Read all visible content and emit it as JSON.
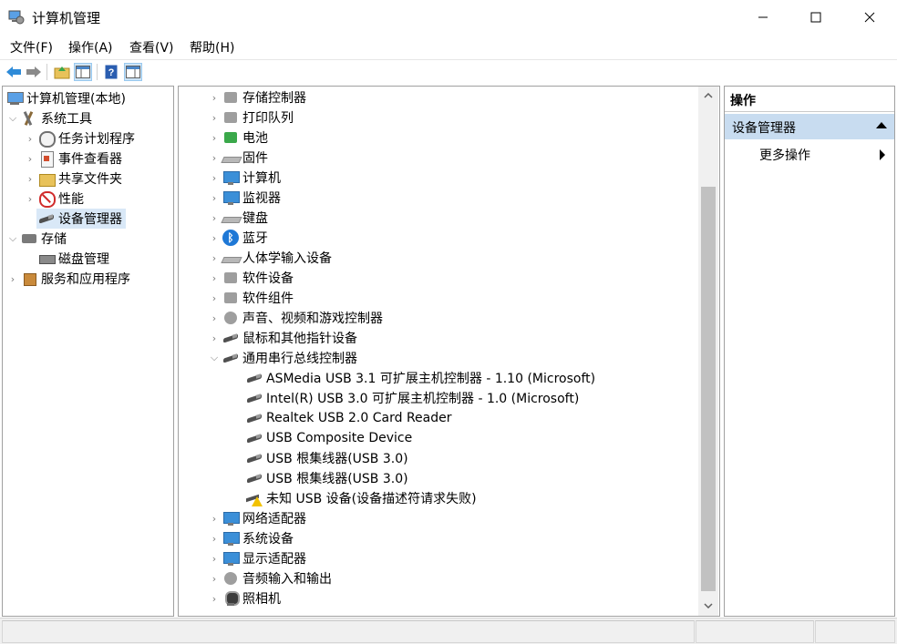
{
  "window": {
    "title": "计算机管理",
    "minimize_icon": "minimize-icon",
    "maximize_icon": "maximize-icon",
    "close_icon": "close-icon"
  },
  "menu": [
    {
      "label": "文件(F)"
    },
    {
      "label": "操作(A)"
    },
    {
      "label": "查看(V)"
    },
    {
      "label": "帮助(H)"
    }
  ],
  "toolbar": {
    "buttons": [
      "back-icon",
      "forward-icon",
      "up-folder-icon",
      "show-hide-console-tree-icon",
      "help-icon",
      "properties-icon"
    ]
  },
  "left_tree": {
    "items": [
      {
        "label": "计算机管理(本地)",
        "icon": "computer-management-icon"
      },
      {
        "label": "系统工具",
        "icon": "system-tools-icon"
      },
      {
        "label": "任务计划程序",
        "icon": "task-scheduler-icon"
      },
      {
        "label": "事件查看器",
        "icon": "event-viewer-icon"
      },
      {
        "label": "共享文件夹",
        "icon": "shared-folders-icon"
      },
      {
        "label": "性能",
        "icon": "performance-icon"
      },
      {
        "label": "设备管理器",
        "icon": "device-manager-icon",
        "selected": true
      },
      {
        "label": "存储",
        "icon": "storage-icon"
      },
      {
        "label": "磁盘管理",
        "icon": "disk-management-icon"
      },
      {
        "label": "服务和应用程序",
        "icon": "services-applications-icon"
      }
    ]
  },
  "device_tree": {
    "items": [
      {
        "label": "存储控制器",
        "icon": "storage-controller-icon"
      },
      {
        "label": "打印队列",
        "icon": "print-queue-icon"
      },
      {
        "label": "电池",
        "icon": "battery-icon"
      },
      {
        "label": "固件",
        "icon": "firmware-icon"
      },
      {
        "label": "计算机",
        "icon": "computer-icon"
      },
      {
        "label": "监视器",
        "icon": "monitor-icon"
      },
      {
        "label": "键盘",
        "icon": "keyboard-icon"
      },
      {
        "label": "蓝牙",
        "icon": "bluetooth-icon"
      },
      {
        "label": "人体学输入设备",
        "icon": "hid-icon"
      },
      {
        "label": "软件设备",
        "icon": "software-device-icon"
      },
      {
        "label": "软件组件",
        "icon": "software-component-icon"
      },
      {
        "label": "声音、视频和游戏控制器",
        "icon": "sound-icon"
      },
      {
        "label": "鼠标和其他指针设备",
        "icon": "mouse-icon"
      },
      {
        "label": "通用串行总线控制器",
        "icon": "usb-controller-icon",
        "expanded": true
      },
      {
        "label": "ASMedia USB 3.1 可扩展主机控制器 - 1.10 (Microsoft)",
        "icon": "usb-device-icon",
        "child": true
      },
      {
        "label": "Intel(R) USB 3.0 可扩展主机控制器 - 1.0 (Microsoft)",
        "icon": "usb-device-icon",
        "child": true
      },
      {
        "label": "Realtek USB 2.0 Card Reader",
        "icon": "usb-device-icon",
        "child": true
      },
      {
        "label": "USB Composite Device",
        "icon": "usb-device-icon",
        "child": true
      },
      {
        "label": "USB 根集线器(USB 3.0)",
        "icon": "usb-device-icon",
        "child": true
      },
      {
        "label": "USB 根集线器(USB 3.0)",
        "icon": "usb-device-icon",
        "child": true
      },
      {
        "label": "未知 USB 设备(设备描述符请求失败)",
        "icon": "usb-warning-icon",
        "child": true
      },
      {
        "label": "网络适配器",
        "icon": "network-adapter-icon"
      },
      {
        "label": "系统设备",
        "icon": "system-device-icon"
      },
      {
        "label": "显示适配器",
        "icon": "display-adapter-icon"
      },
      {
        "label": "音频输入和输出",
        "icon": "audio-io-icon"
      },
      {
        "label": "照相机",
        "icon": "camera-icon"
      }
    ]
  },
  "actions": {
    "header": "操作",
    "section": "设备管理器",
    "more": "更多操作"
  },
  "colors": {
    "selection": "#d9e8f7",
    "action_section": "#c8dcf0",
    "warning": "#f2c200"
  }
}
